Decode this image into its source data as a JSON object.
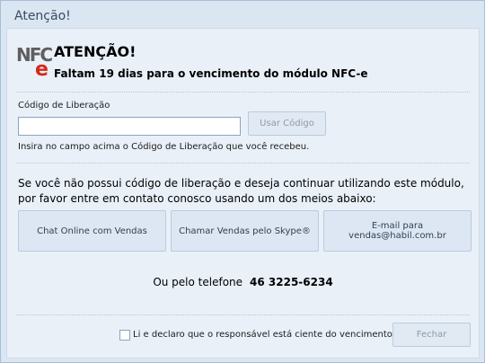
{
  "window": {
    "title": "Atenção!"
  },
  "header": {
    "heading": "ATENÇÃO!",
    "message": "Faltam 19 dias para o vencimento do módulo NFC-e",
    "logo_text": "NFC",
    "logo_accent": "e"
  },
  "release": {
    "label": "Código de Liberação",
    "value": "",
    "use_button": "Usar Código",
    "hint": "Insira no campo acima o Código de Liberação que você recebeu."
  },
  "contact": {
    "info": "Se você não possui código de liberação e deseja continuar utilizando este módulo, por favor entre em contato conosco usando um dos meios abaixo:",
    "chat_button": "Chat Online com Vendas",
    "skype_button": "Chamar Vendas pelo Skype®",
    "email_button_line1": "E-mail para",
    "email_button_line2": "vendas@habil.com.br",
    "phone_prefix": "Ou pelo telefone",
    "phone_number": "46 3225-6234"
  },
  "footer": {
    "checkbox_label": "Li e declaro que o responsável está ciente do vencimento!",
    "checkbox_checked": false,
    "close_button": "Fechar"
  },
  "colors": {
    "accent_red": "#d6281b",
    "panel": "#e9f0f8",
    "window": "#dbe6f3"
  }
}
